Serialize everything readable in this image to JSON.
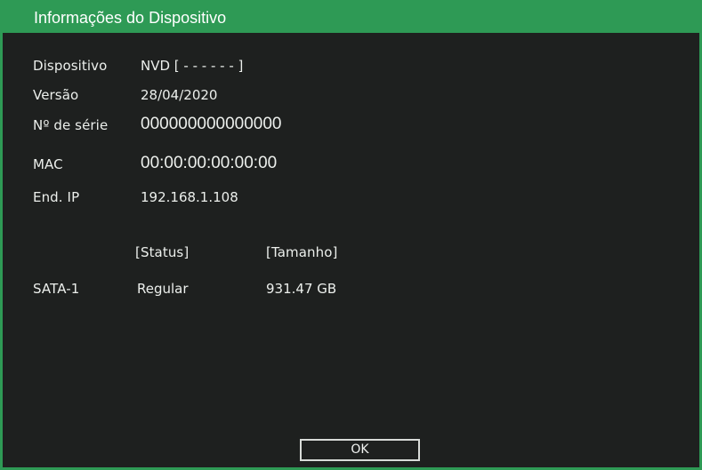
{
  "window": {
    "title": "Informações do Dispositivo"
  },
  "info": {
    "device_label": "Dispositivo",
    "device_value": "NVD [ - - - - - - ]",
    "version_label": "Versão",
    "version_value": "28/04/2020",
    "serial_label": "Nº de série",
    "serial_value": "000000000000000",
    "mac_label": "MAC",
    "mac_value": "00:00:00:00:00:00",
    "ip_label": "End. IP",
    "ip_value": "192.168.1.108"
  },
  "disks": {
    "headers": {
      "status": "[Status]",
      "size": "[Tamanho]"
    },
    "rows": [
      {
        "name": "SATA-1",
        "status": "Regular",
        "size": "931.47 GB"
      }
    ]
  },
  "actions": {
    "ok_label": "OK"
  },
  "colors": {
    "accent": "#2e9a55",
    "background": "#1e201f",
    "text": "#ecefec"
  }
}
